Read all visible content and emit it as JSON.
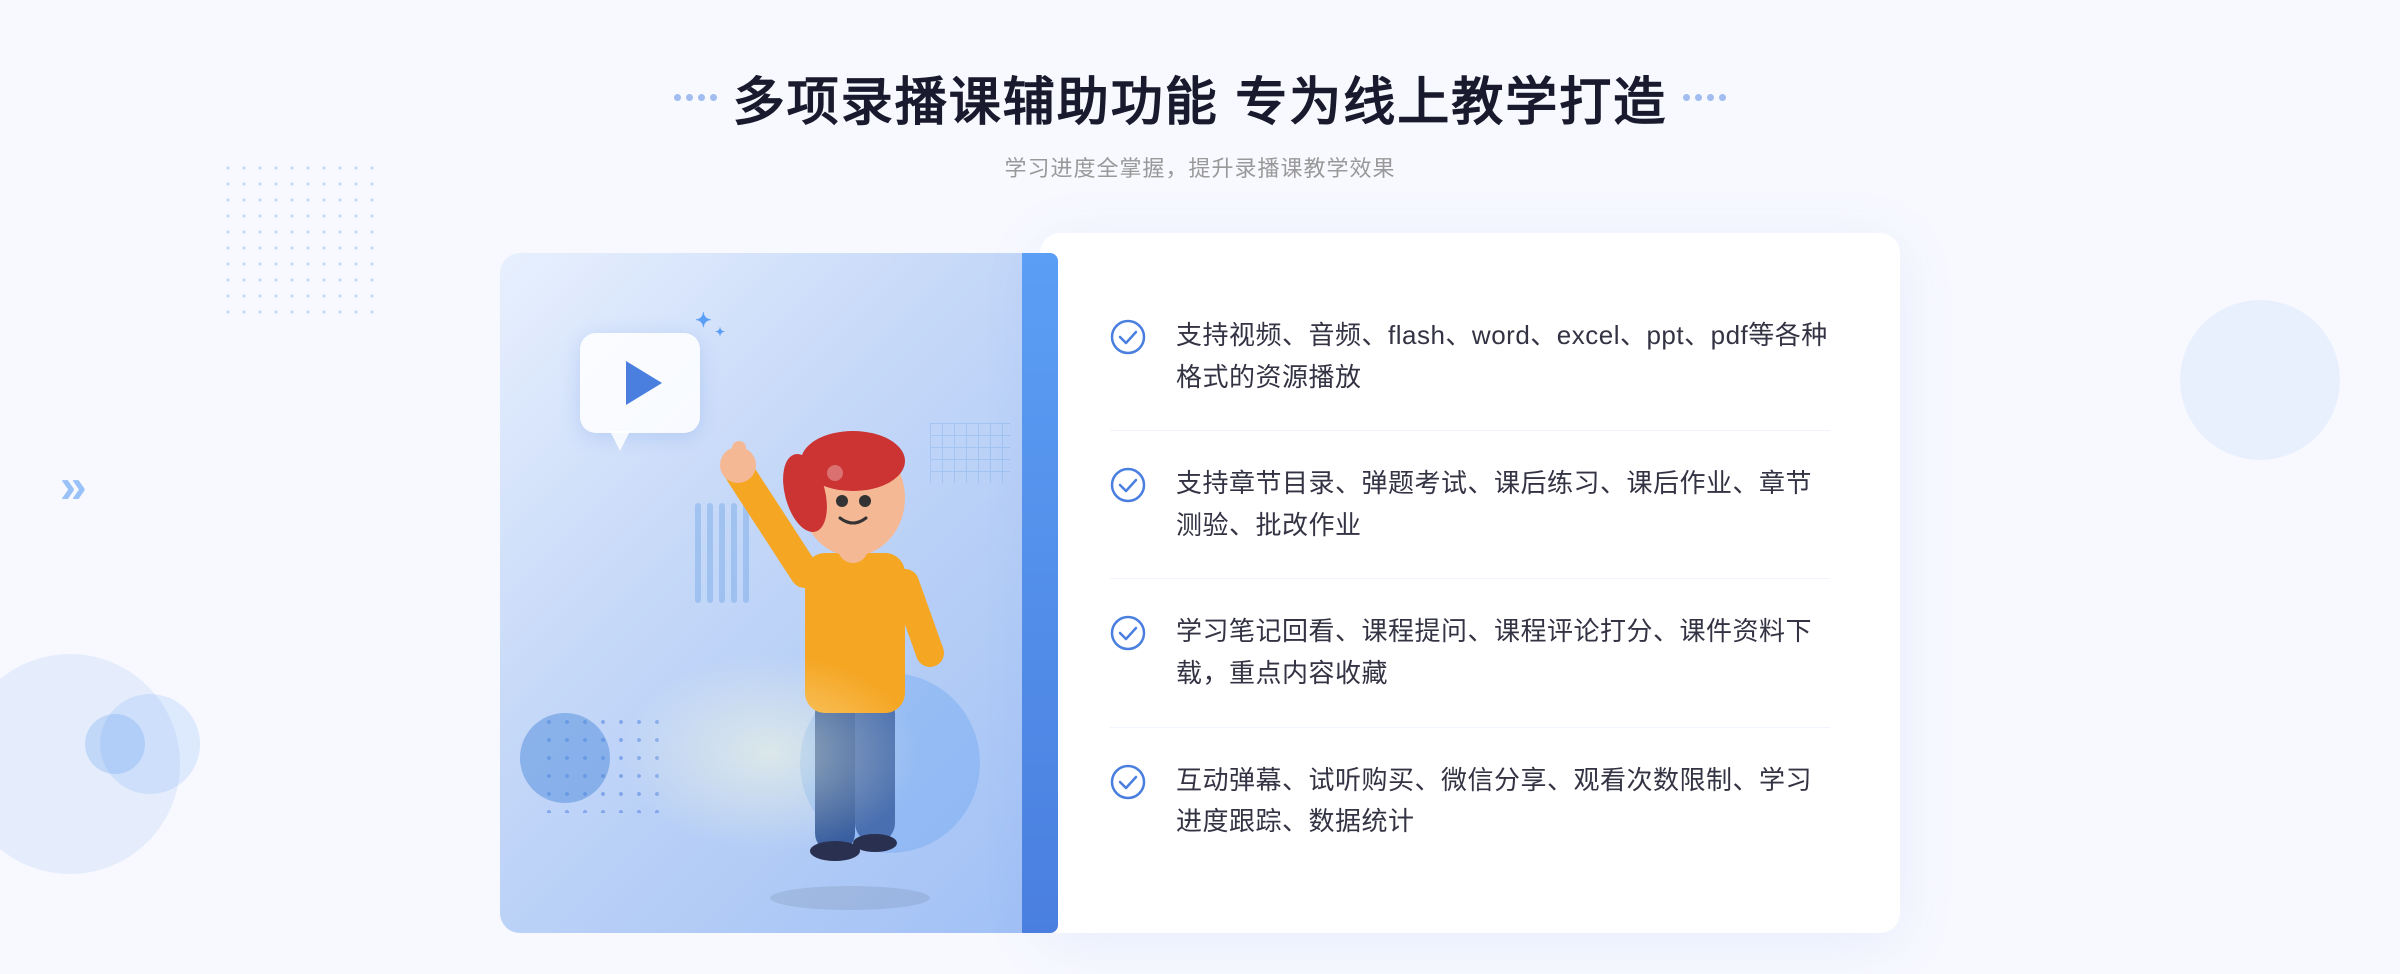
{
  "header": {
    "title": "多项录播课辅助功能 专为线上教学打造",
    "subtitle": "学习进度全掌握，提升录播课教学效果",
    "title_decorator_left": "⠿ ⠿",
    "title_decorator_right": "⠿ ⠿"
  },
  "features": [
    {
      "id": "feature-1",
      "text": "支持视频、音频、flash、word、excel、ppt、pdf等各种格式的资源播放"
    },
    {
      "id": "feature-2",
      "text": "支持章节目录、弹题考试、课后练习、课后作业、章节测验、批改作业"
    },
    {
      "id": "feature-3",
      "text": "学习笔记回看、课程提问、课程评论打分、课件资料下载，重点内容收藏"
    },
    {
      "id": "feature-4",
      "text": "互动弹幕、试听购买、微信分享、观看次数限制、学习进度跟踪、数据统计"
    }
  ],
  "colors": {
    "primary": "#4a7fdf",
    "accent": "#5b9ef5",
    "text_dark": "#333344",
    "text_gray": "#999999",
    "bg_light": "#f8f9ff",
    "check_color": "#4a7fdf"
  },
  "decorations": {
    "chevron_left": "»",
    "sparkle": "✦"
  }
}
